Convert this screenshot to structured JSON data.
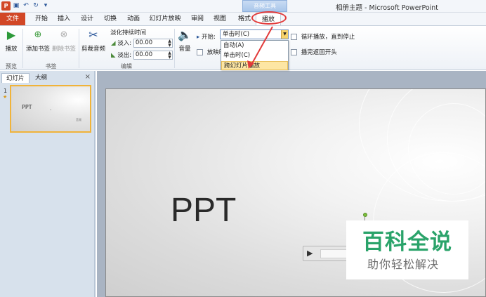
{
  "titlebar": {
    "app_icon": "P",
    "document_title": "相册主题 - Microsoft PowerPoint",
    "context_tab_group": "音频工具",
    "quick_access": [
      "save-icon",
      "undo-icon",
      "redo-icon",
      "customize-icon"
    ]
  },
  "tabs": {
    "file": "文件",
    "home": "开始",
    "insert": "插入",
    "design": "设计",
    "transitions": "切换",
    "animations": "动画",
    "slideshow": "幻灯片放映",
    "review": "审阅",
    "view": "视图",
    "format": "格式",
    "playback": "播放"
  },
  "ribbon": {
    "preview": {
      "play_label": "播放",
      "group_label": "预览"
    },
    "bookmarks": {
      "add_label": "添加书签",
      "remove_label": "删除书签",
      "group_label": "书签"
    },
    "editing": {
      "trim_label": "剪裁音频",
      "fade_title": "淡化持续时间",
      "fade_in_label": "淡入:",
      "fade_in_value": "00.00",
      "fade_out_label": "淡出:",
      "fade_out_value": "00.00",
      "group_label": "编辑"
    },
    "audio_options": {
      "volume_label": "音量",
      "start_label": "开始:",
      "start_value": "单击时(C)",
      "hide_label": "放映时隐藏",
      "loop_label": "循环播放，直到停止",
      "rewind_label": "播完返回开头"
    },
    "start_dropdown": {
      "options": [
        "自动(A)",
        "单击时(C)",
        "跨幻灯片播放"
      ],
      "highlighted_index": 2
    }
  },
  "left_pane": {
    "tab_slides": "幻灯片",
    "tab_outline": "大纲",
    "close": "×",
    "slide_number": "1",
    "thumb_title": "PPT",
    "thumb_dot": "•",
    "thumb_small": "音频"
  },
  "slide": {
    "title": "PPT"
  },
  "watermark": {
    "main": "百科全说",
    "sub": "助你轻松解决"
  },
  "colors": {
    "accent_file_tab": "#d24726",
    "annotation_red": "#e23a3a",
    "watermark_green": "#2aa36a",
    "dropdown_highlight": "#fde6a4"
  }
}
